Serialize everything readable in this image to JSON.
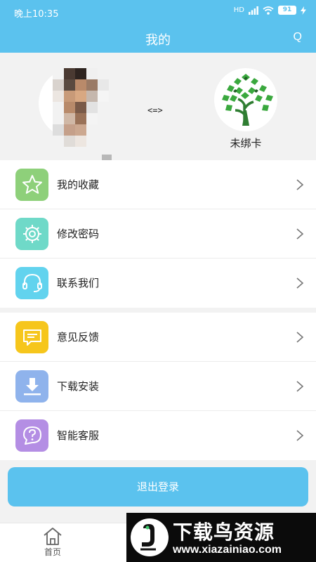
{
  "status_bar": {
    "time": "晚上10:35",
    "network": "HD",
    "battery": "91"
  },
  "header": {
    "title": "我的",
    "action": "Q"
  },
  "profile": {
    "bind_symbol": "<=>",
    "card_status": "未绑卡"
  },
  "menu_group_1": [
    {
      "label": "我的收藏",
      "icon": "star-icon",
      "color": "#8ed07a"
    },
    {
      "label": "修改密码",
      "icon": "gear-icon",
      "color": "#6fd9c8"
    },
    {
      "label": "联系我们",
      "icon": "headset-icon",
      "color": "#62d3ee"
    }
  ],
  "menu_group_2": [
    {
      "label": "意见反馈",
      "icon": "feedback-icon",
      "color": "#f6c61c"
    },
    {
      "label": "下载安装",
      "icon": "download-icon",
      "color": "#8fb3ec"
    },
    {
      "label": "智能客服",
      "icon": "question-icon",
      "color": "#b48ee4"
    }
  ],
  "logout_label": "退出登录",
  "tabbar": {
    "home_label": "首页"
  },
  "watermark": {
    "title": "下载鸟资源",
    "url": "www.xiazainiao.com"
  },
  "colors": {
    "primary": "#5bc2ee"
  }
}
